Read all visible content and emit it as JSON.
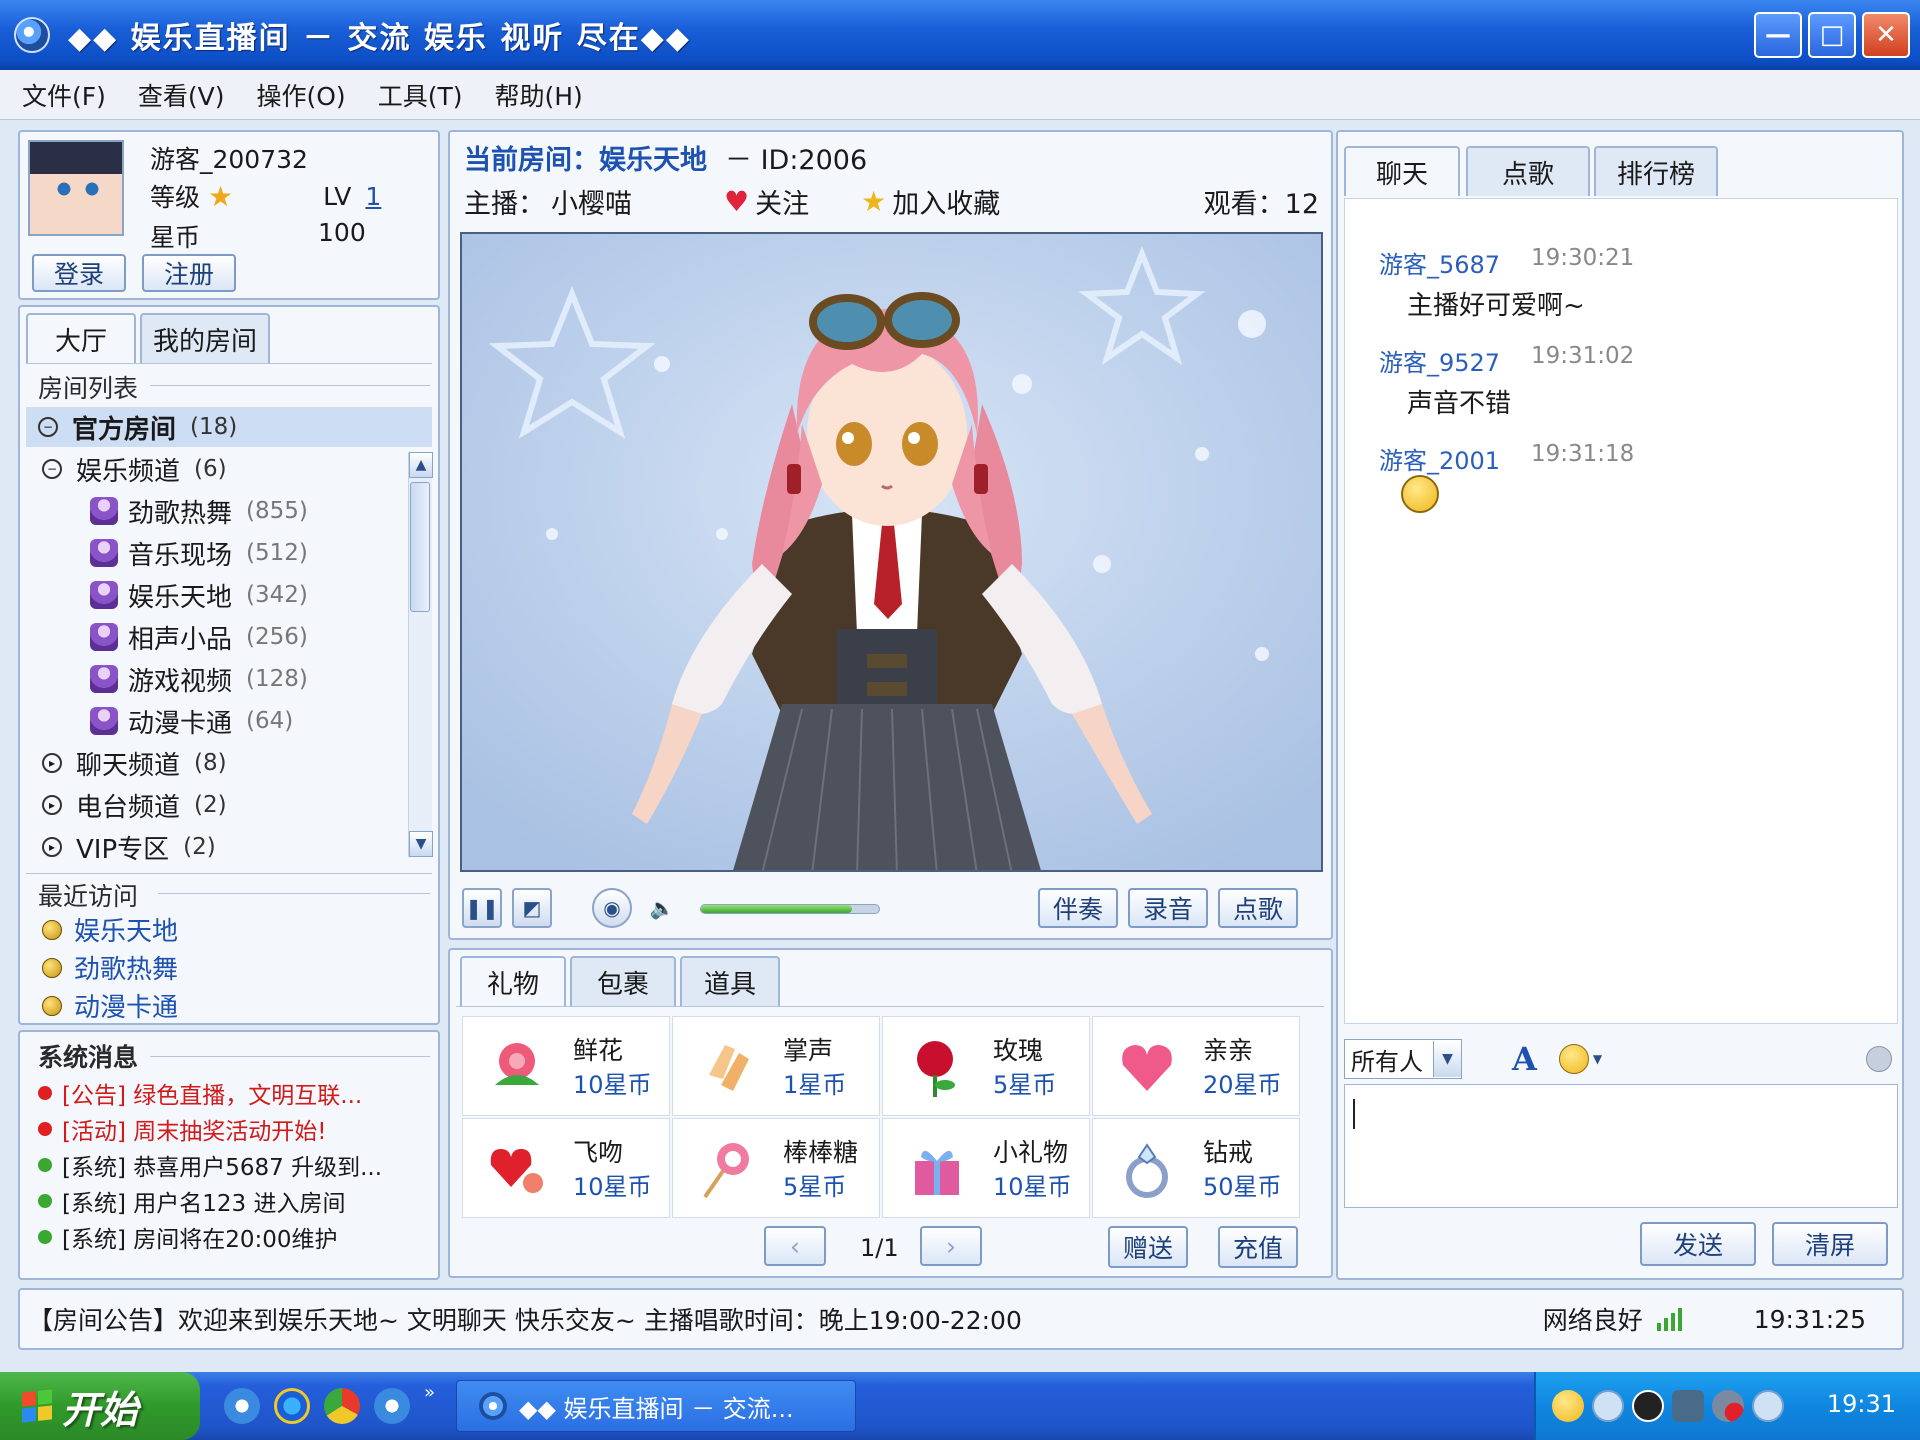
{
  "window": {
    "title": "◆◆ 娱乐直播间 － 交流 娱乐 视听 尽在◆◆",
    "min_label": "—",
    "max_label": "□",
    "close_label": "✕"
  },
  "menu": [
    "文件(F)",
    "查看(V)",
    "操作(O)",
    "工具(T)",
    "帮助(H)"
  ],
  "user": {
    "name": "游客_200732",
    "level_label": "等级",
    "lv_label": "LV",
    "lv_value": "1",
    "coins_label": "星币",
    "coins_value": "100",
    "login_label": "登录",
    "register_label": "注册"
  },
  "left_tabs": [
    "大厅",
    "我的房间"
  ],
  "room_list": {
    "header": "房间列表",
    "official": "官方房间",
    "official_count": "(18)",
    "ent_channel": "娱乐频道",
    "ent_count": "(6)",
    "rooms": [
      {
        "name": "劲歌热舞",
        "count": "(855)"
      },
      {
        "name": "音乐现场",
        "count": "(512)"
      },
      {
        "name": "娱乐天地",
        "count": "(342)"
      },
      {
        "name": "相声小品",
        "count": "(256)"
      },
      {
        "name": "游戏视频",
        "count": "(128)"
      },
      {
        "name": "动漫卡通",
        "count": "(64)"
      }
    ],
    "chat_channel": "聊天频道",
    "chat_count": "(8)",
    "radio_channel": "电台频道",
    "radio_count": "(2)",
    "vip_channel": "VIP专区",
    "vip_count": "(2)"
  },
  "recent": {
    "header": "最近访问",
    "items": [
      "娱乐天地",
      "劲歌热舞",
      "动漫卡通"
    ]
  },
  "system": {
    "header": "系统消息",
    "messages": [
      {
        "text": "[公告] 绿色直播，文明互联...",
        "color": "#d11a1a"
      },
      {
        "text": "[活动] 周末抽奖活动开始!",
        "color": "#d11a1a"
      },
      {
        "text": "[系统] 恭喜用户5687 升级到...",
        "color": "#1a1a1a"
      },
      {
        "text": "[系统] 用户名123 进入房间",
        "color": "#1a1a1a"
      },
      {
        "text": "[系统] 房间将在20:00维护",
        "color": "#1a1a1a"
      }
    ]
  },
  "room": {
    "current_label": "当前房间：娱乐天地",
    "id_text": "－ ID:2006",
    "host_label": "主播：",
    "host_name": "小樱喵",
    "follow_label": "关注",
    "fav_label": "加入收藏",
    "viewers_label": "观看：12"
  },
  "player": {
    "accompany_label": "伴奏",
    "record_label": "录音",
    "request_label": "点歌",
    "volume_percent": 85
  },
  "gift_tabs": [
    "礼物",
    "包裹",
    "道具"
  ],
  "gifts": [
    {
      "name": "鲜花",
      "price": "10星币",
      "icon": "flower-icon"
    },
    {
      "name": "掌声",
      "price": "1星币",
      "icon": "clap-icon"
    },
    {
      "name": "玫瑰",
      "price": "5星币",
      "icon": "rose-icon"
    },
    {
      "name": "亲亲",
      "price": "20星币",
      "icon": "kiss-icon"
    },
    {
      "name": "飞吻",
      "price": "10星币",
      "icon": "fly-kiss-icon"
    },
    {
      "name": "棒棒糖",
      "price": "5星币",
      "icon": "lollipop-icon"
    },
    {
      "name": "小礼物",
      "price": "10星币",
      "icon": "gift-box-icon"
    },
    {
      "name": "钻戒",
      "price": "50星币",
      "icon": "ring-icon"
    }
  ],
  "gift_pager": {
    "page": "1/1",
    "send_label": "赠送",
    "recharge_label": "充值"
  },
  "chat_tabs": [
    "聊天",
    "点歌",
    "排行榜"
  ],
  "chat": [
    {
      "user": "游客_5687",
      "time": "19:30:21",
      "msg": "主播好可爱啊~"
    },
    {
      "user": "游客_9527",
      "time": "19:31:02",
      "msg": "声音不错"
    },
    {
      "user": "游客_2001",
      "time": "19:31:18",
      "msg": ""
    }
  ],
  "chat_input": {
    "target": "所有人",
    "send_label": "发送",
    "clear_label": "清屏"
  },
  "announcement": {
    "text": "【房间公告】欢迎来到娱乐天地~ 文明聊天 快乐交友~ 主播唱歌时间：晚上19:00-22:00",
    "network": "网络良好",
    "time": "19:31:25"
  },
  "taskbar": {
    "start_label": "开始",
    "task_label": "◆◆ 娱乐直播间 － 交流...",
    "clock": "19:31"
  }
}
